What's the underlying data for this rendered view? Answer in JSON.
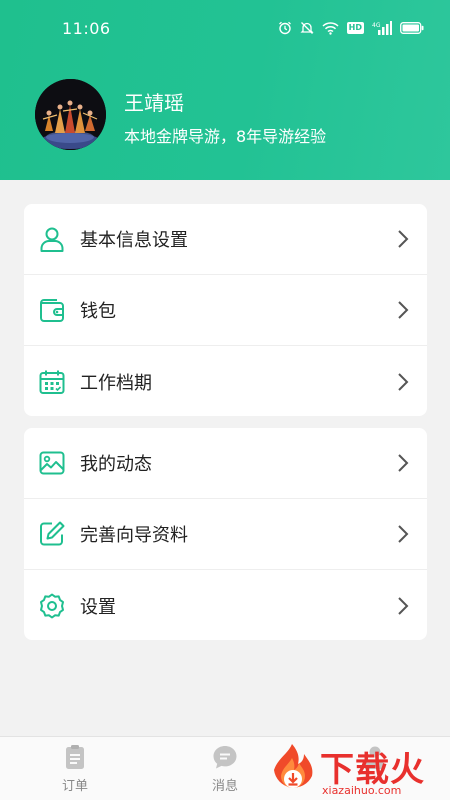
{
  "status_bar": {
    "time": "11:06",
    "icons": [
      "alarm-icon",
      "mute-icon",
      "wifi-icon",
      "hd-icon",
      "signal-4g-icon",
      "battery-icon"
    ],
    "hd_label": "HD",
    "network_label": "4G"
  },
  "profile": {
    "name": "王靖瑶",
    "description": "本地金牌导游，8年导游经验"
  },
  "menu_group_1": [
    {
      "label": "基本信息设置",
      "icon": "user-icon"
    },
    {
      "label": "钱包",
      "icon": "wallet-icon"
    },
    {
      "label": "工作档期",
      "icon": "calendar-icon"
    }
  ],
  "menu_group_2": [
    {
      "label": "我的动态",
      "icon": "image-icon"
    },
    {
      "label": "完善向导资料",
      "icon": "edit-icon"
    },
    {
      "label": "设置",
      "icon": "gear-icon"
    }
  ],
  "tabbar": {
    "orders": "订单",
    "messages": "消息"
  },
  "watermark": {
    "text": "下载火",
    "url": "xiazaihuo.com"
  },
  "colors": {
    "accent": "#22c294",
    "icon": "#1fbf8f",
    "chevron": "#555555",
    "watermark": "#e8302d"
  }
}
